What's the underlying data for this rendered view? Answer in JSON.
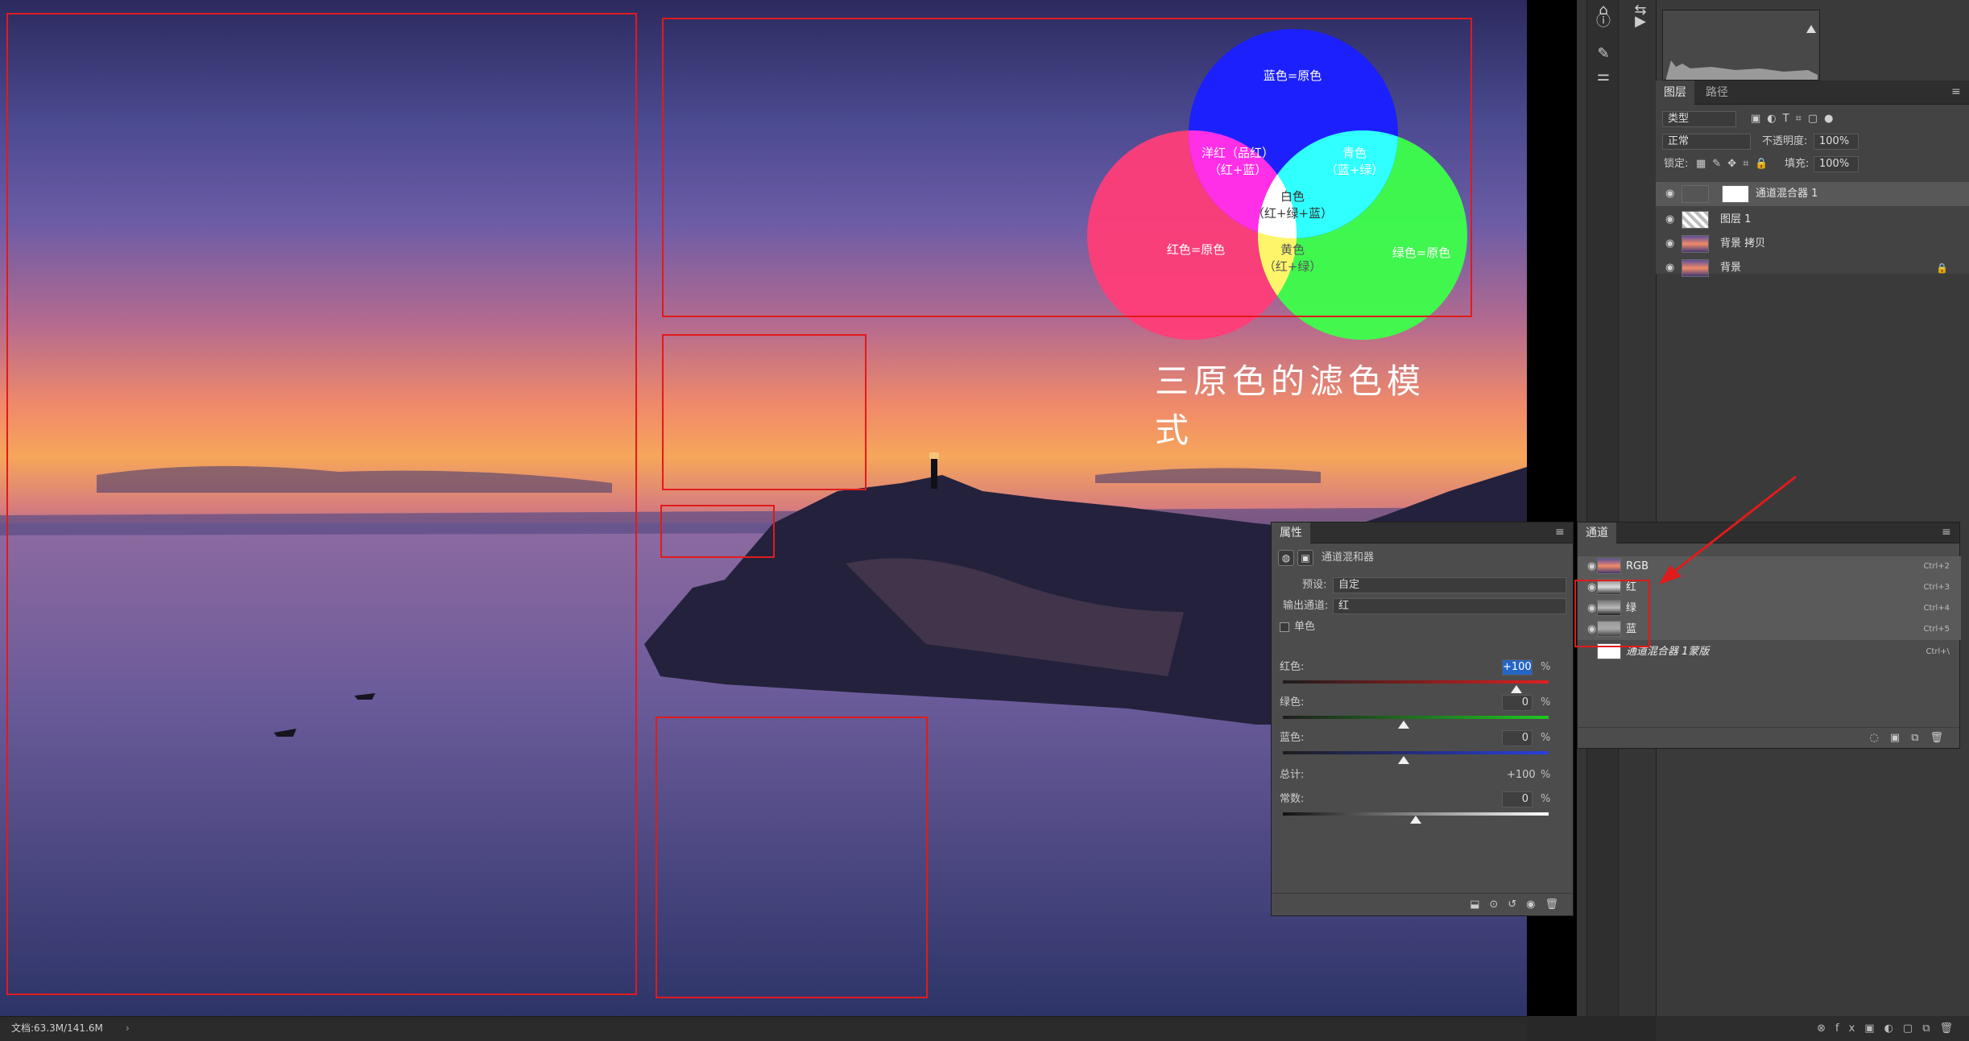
{
  "diagram": {
    "title": "三原色的滤色模式",
    "labels": {
      "blue": "蓝色=原色",
      "magenta": "洋红（品红）\n（红+蓝）",
      "cyan": "青色\n（蓝+绿）",
      "white": "白色\n（红+绿+蓝）",
      "red": "红色=原色",
      "yellow": "黄色\n（红+绿）",
      "green": "绿色=原色"
    }
  },
  "layers_panel": {
    "tabs": [
      "图层",
      "路径"
    ],
    "filter_label": "类型",
    "blend_mode": "正常",
    "opacity_label": "不透明度:",
    "opacity": "100%",
    "lock_label": "锁定:",
    "fill_label": "填充:",
    "fill": "100%",
    "layers": [
      {
        "name": "通道混合器 1"
      },
      {
        "name": "图层 1"
      },
      {
        "name": "背景 拷贝"
      },
      {
        "name": "背景"
      }
    ]
  },
  "properties_panel": {
    "tab": "属性",
    "adjustment": "通道混和器",
    "preset_label": "预设:",
    "preset": "自定",
    "output_label": "输出通道:",
    "output": "红",
    "mono_label": "单色",
    "sliders": [
      {
        "label": "红色:",
        "value": "+100",
        "unit": "%",
        "level": 1.0
      },
      {
        "label": "绿色:",
        "value": "0",
        "unit": "%",
        "level": 0.5
      },
      {
        "label": "蓝色:",
        "value": "0",
        "unit": "%",
        "level": 0.5
      }
    ],
    "total_label": "总计:",
    "total": "+100",
    "total_unit": "%",
    "constant_label": "常数:",
    "constant": "0",
    "constant_unit": "%"
  },
  "channels_panel": {
    "tab": "通道",
    "channels": [
      {
        "name": "RGB",
        "shortcut": "Ctrl+2"
      },
      {
        "name": "红",
        "shortcut": "Ctrl+3"
      },
      {
        "name": "绿",
        "shortcut": "Ctrl+4"
      },
      {
        "name": "蓝",
        "shortcut": "Ctrl+5"
      },
      {
        "name": "通道混合器 1蒙版",
        "shortcut": "Ctrl+\\"
      }
    ]
  },
  "status": {
    "doc": "文档:63.3M/141.6M"
  },
  "colors": {
    "annotation": "#e01b1b"
  }
}
